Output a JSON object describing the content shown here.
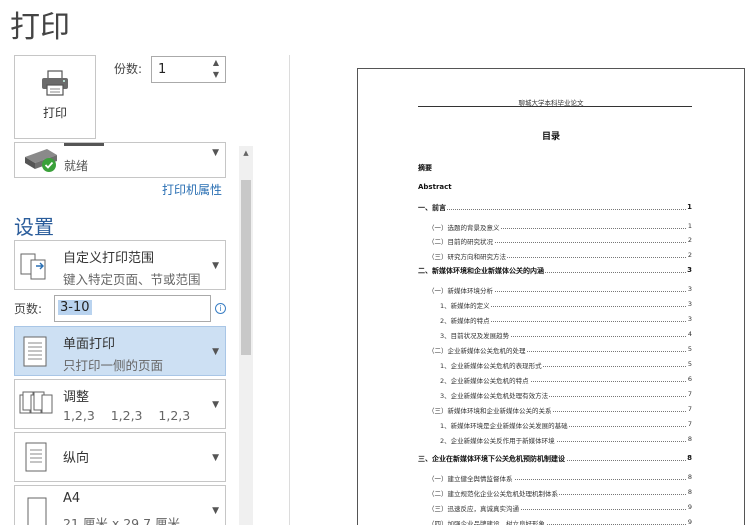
{
  "header": {
    "title": "打印"
  },
  "print_button": {
    "label": "打印",
    "icon": "printer-icon"
  },
  "copies": {
    "label": "份数:",
    "value": "1"
  },
  "printer": {
    "status": "就绪",
    "properties_link": "打印机属性",
    "icon": "printer-ready-icon"
  },
  "settings": {
    "heading": "设置",
    "range": {
      "main": "自定义打印范围",
      "sub": "键入特定页面、节或范围"
    },
    "pages": {
      "label": "页数:",
      "value": "3-10"
    },
    "sides": {
      "main": "单面打印",
      "sub": "只打印一侧的页面"
    },
    "collate": {
      "main": "调整",
      "sub": "1,2,3    1,2,3    1,2,3"
    },
    "orientation": {
      "main": "纵向"
    },
    "paper": {
      "main": "A4",
      "sub": "21 厘米 x 29.7 厘米"
    }
  },
  "preview": {
    "header_text": "聊城大学本科毕业论文",
    "toc_title": "目录",
    "entries": [
      {
        "text": "摘要",
        "page": "",
        "bold": true,
        "indent": 0
      },
      {
        "text": "Abstract",
        "page": "",
        "bold": true,
        "indent": 0
      },
      {
        "text": "一、前言",
        "page": "1",
        "bold": true,
        "indent": 0
      },
      {
        "text": "（一）选题的背景及意义",
        "page": "1",
        "bold": false,
        "indent": 1
      },
      {
        "text": "（二）目前的研究状况",
        "page": "2",
        "bold": false,
        "indent": 1
      },
      {
        "text": "（三）研究方向和研究方法",
        "page": "2",
        "bold": false,
        "indent": 1
      },
      {
        "text": "二、新媒体环境和企业新媒体公关的内涵",
        "page": "3",
        "bold": true,
        "indent": 0
      },
      {
        "text": "（一）新媒体环境分析",
        "page": "3",
        "bold": false,
        "indent": 1
      },
      {
        "text": "1、新媒体的定义",
        "page": "3",
        "bold": false,
        "indent": 2
      },
      {
        "text": "2、新媒体的特点",
        "page": "3",
        "bold": false,
        "indent": 2
      },
      {
        "text": "3、目前状况及发展趋势",
        "page": "4",
        "bold": false,
        "indent": 2
      },
      {
        "text": "（二）企业新媒体公关危机的处理",
        "page": "5",
        "bold": false,
        "indent": 1
      },
      {
        "text": "1、企业新媒体公关危机的表现形式",
        "page": "5",
        "bold": false,
        "indent": 2
      },
      {
        "text": "2、企业新媒体公关危机的特点",
        "page": "6",
        "bold": false,
        "indent": 2
      },
      {
        "text": "3、企业新媒体公关危机处理有效方法",
        "page": "7",
        "bold": false,
        "indent": 2
      },
      {
        "text": "（三）新媒体环境和企业新媒体公关的关系",
        "page": "7",
        "bold": false,
        "indent": 1
      },
      {
        "text": "1、新媒体环境是企业新媒体公关发展的基础",
        "page": "7",
        "bold": false,
        "indent": 2
      },
      {
        "text": "2、企业新媒体公关反作用于新媒体环境",
        "page": "8",
        "bold": false,
        "indent": 2
      },
      {
        "text": "三、企业在新媒体环境下公关危机预防机制建设",
        "page": "8",
        "bold": true,
        "indent": 0
      },
      {
        "text": "（一）建立健全舆情监督体系",
        "page": "8",
        "bold": false,
        "indent": 1
      },
      {
        "text": "（二）建立规范化企业公关危机处理机制体系",
        "page": "8",
        "bold": false,
        "indent": 1
      },
      {
        "text": "（三）迅速反应，真诚真实沟通",
        "page": "9",
        "bold": false,
        "indent": 1
      },
      {
        "text": "（四）加强企业品牌建设，树立良好形象",
        "page": "9",
        "bold": false,
        "indent": 1
      }
    ]
  }
}
